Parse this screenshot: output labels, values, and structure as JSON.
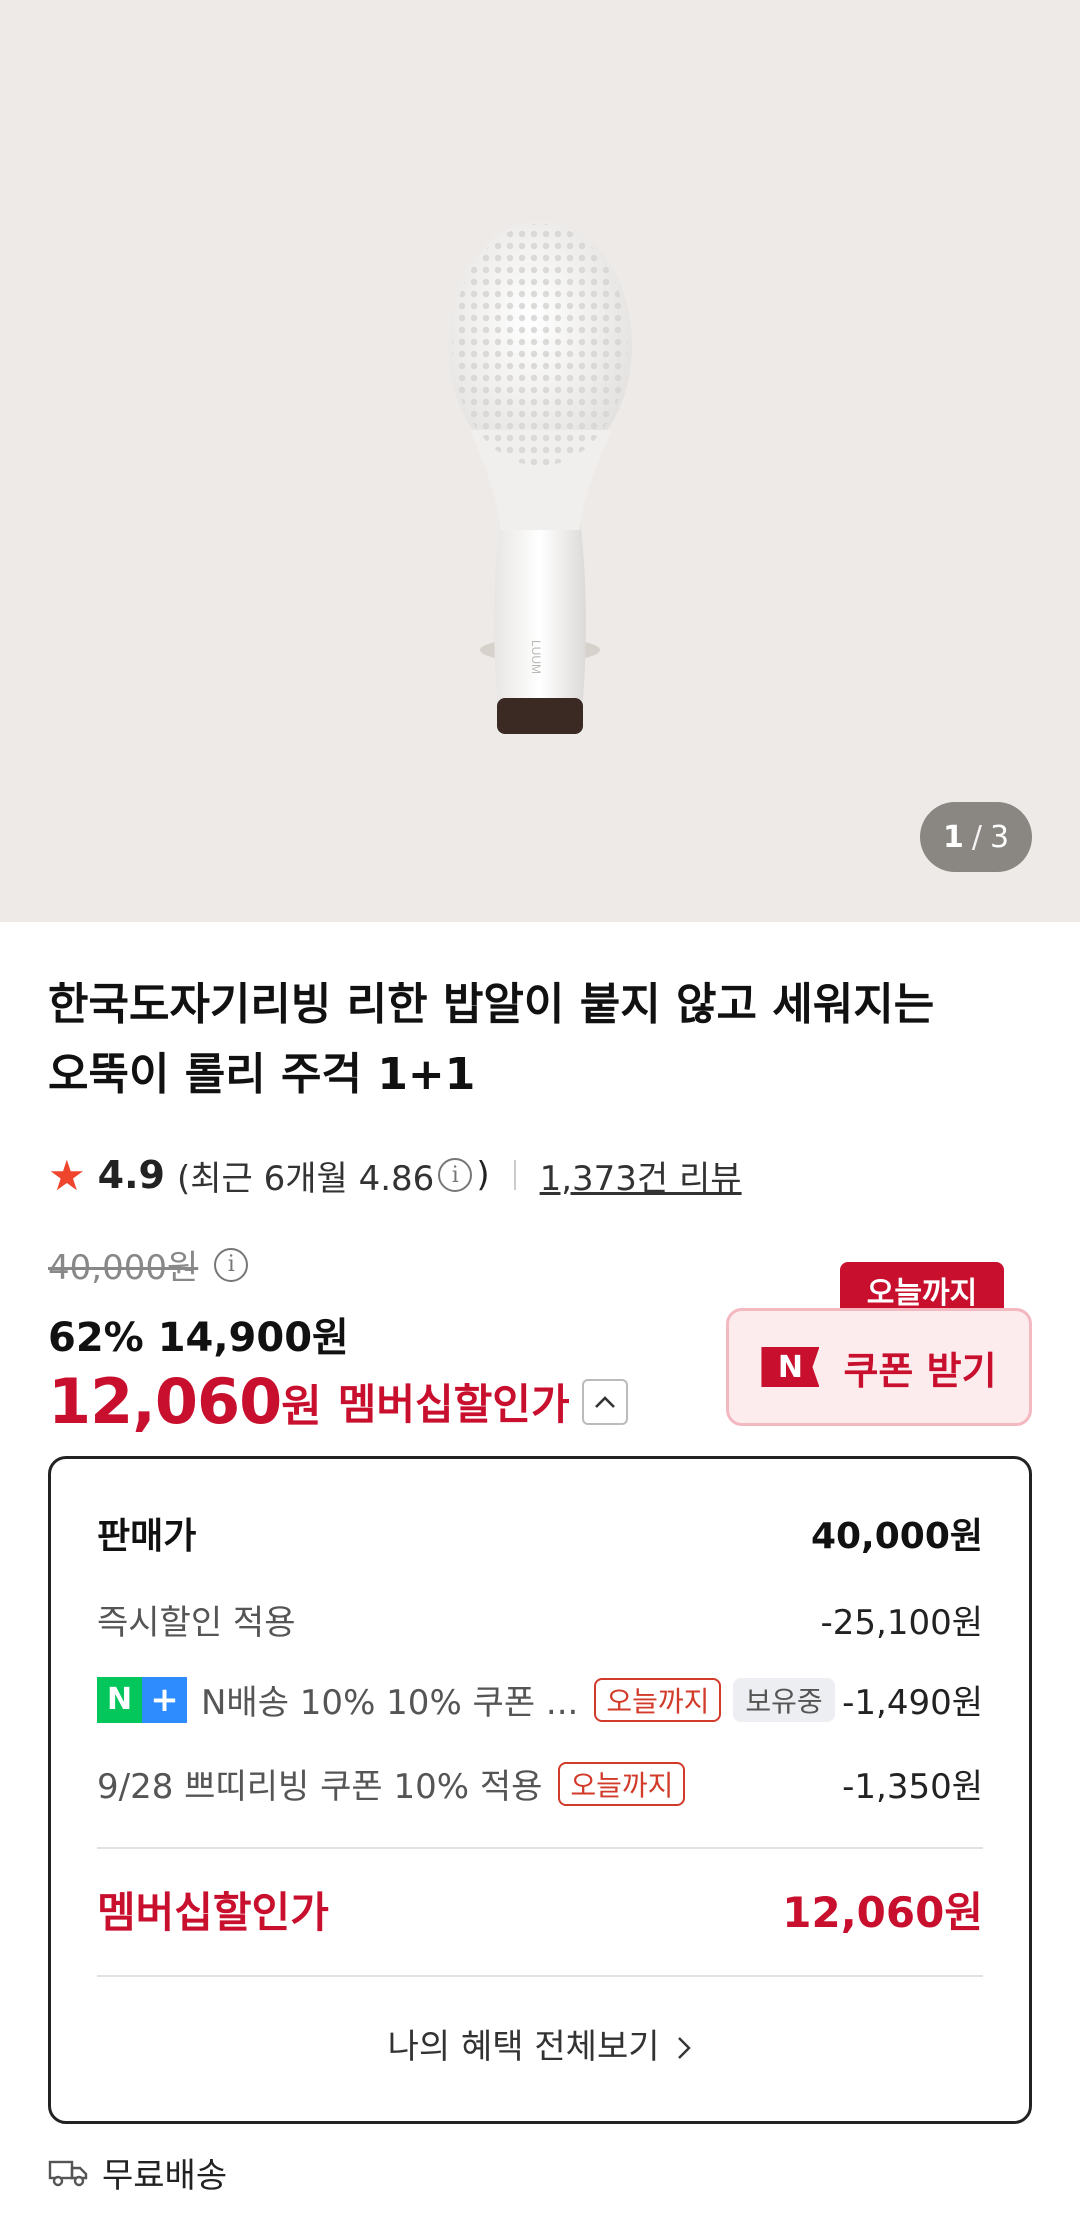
{
  "gallery": {
    "current": "1",
    "separator": "/",
    "total": "3"
  },
  "product": {
    "title_line1": "한국도자기리빙 리한 밥알이 붙지 않고 세워지는",
    "title_line2": "오뚝이 롤리 주걱 1+1",
    "handle_brand": "LUUM"
  },
  "rating": {
    "score": "4.9",
    "recent_open": "(최근 6개월 4.86",
    "recent_close": ")",
    "reviews": "1,373건 리뷰"
  },
  "price": {
    "original": "40,000원",
    "discount_rate": "62%",
    "discount_price": "14,900원",
    "member_price": "12,060",
    "member_unit": "원",
    "member_label": "멤버십할인가"
  },
  "coupon": {
    "tag": "오늘까지",
    "logo": "N",
    "label": "쿠폰 받기"
  },
  "benefit": {
    "sale_label": "판매가",
    "sale_amount": "40,000원",
    "instant_label": "즉시할인 적용",
    "instant_amount": "-25,100원",
    "npay_n": "N",
    "npay_plus": "+",
    "ncoupon_label": "N배송 10% 10% 쿠폰 ...",
    "ncoupon_chip": "오늘까지",
    "ncoupon_held": "보유중",
    "ncoupon_amount": "-1,490원",
    "event_label": "9/28 쁘띠리빙 쿠폰 10% 적용",
    "event_chip": "오늘까지",
    "event_amount": "-1,350원",
    "total_label": "멤버십할인가",
    "total_amount": "12,060원",
    "view_all": "나의 혜택 전체보기"
  },
  "shipping": {
    "label": "무료배송"
  },
  "colors": {
    "brand_red": "#c8102e",
    "naver_green": "#03c75a",
    "npay_blue": "#2f8cff",
    "hero_bg": "#eeeae7"
  }
}
